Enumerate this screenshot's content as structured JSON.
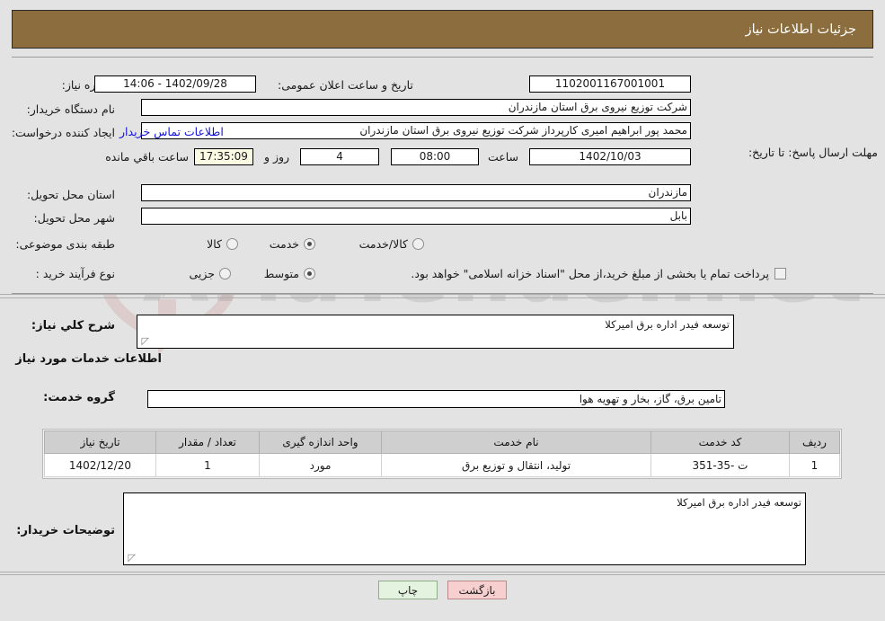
{
  "header": {
    "title": "جزئیات اطلاعات نیاز"
  },
  "form": {
    "need_number_label": "شماره نیاز:",
    "need_number_value": "1102001167001001",
    "announce_label": "تاریخ و ساعت اعلان عمومی:",
    "announce_value": "1402/09/28 - 14:06",
    "buyer_org_label": "نام دستگاه خریدار:",
    "buyer_org_value": "شرکت توزیع نیروی برق استان مازندران",
    "creator_label": "ایجاد کننده درخواست:",
    "creator_value": "محمد پور ابراهیم امیری کارپرداز شرکت توزیع نیروی برق استان مازندران",
    "buyer_contact_link": "اطلاعات تماس خریدار",
    "deadline_label": "مهلت ارسال پاسخ: تا تاریخ:",
    "deadline_date": "1402/10/03",
    "deadline_time_label": "ساعت",
    "deadline_time": "08:00",
    "remaining_days": "4",
    "remaining_days_label": "روز و",
    "remaining_clock": "17:35:09",
    "remaining_suffix": "ساعت باقي مانده",
    "province_label": "استان محل تحویل:",
    "province_value": "مازندران",
    "city_label": "شهر محل تحویل:",
    "city_value": "بابل",
    "classification_label": "طبقه بندی موضوعی:",
    "classification_options": [
      {
        "label": "کالا",
        "selected": false
      },
      {
        "label": "خدمت",
        "selected": true
      },
      {
        "label": "کالا/خدمت",
        "selected": false
      }
    ],
    "process_label": "نوع فرآیند خرید :",
    "process_options": [
      {
        "label": "جزیی",
        "selected": false
      },
      {
        "label": "متوسط",
        "selected": true
      }
    ],
    "treasury_checkbox_label": "پرداخت تمام یا بخشی از مبلغ خرید،از محل \"اسناد خزانه اسلامی\" خواهد بود.",
    "treasury_checked": false
  },
  "summary": {
    "label": "شرح کلي نياز:",
    "value": "توسعه فیدر اداره برق امیرکلا"
  },
  "services_section": {
    "title": "اطلاعات خدمات مورد نیاز",
    "group_label": "گروه خدمت:",
    "group_value": "تامین برق، گاز، بخار و تهویه هوا"
  },
  "table": {
    "columns": [
      "ردیف",
      "کد خدمت",
      "نام خدمت",
      "واحد اندازه گیری",
      "تعداد / مقدار",
      "تاریخ نیاز"
    ],
    "rows": [
      {
        "row": "1",
        "service_code": "ت -35-351",
        "service_name": "تولید، انتقال و توزیع برق",
        "unit": "مورد",
        "quantity": "1",
        "need_date": "1402/12/20"
      }
    ]
  },
  "buyer_notes": {
    "label": "توضیحات خریدار:",
    "value": "توسعه فیدر اداره برق امیرکلا"
  },
  "footer": {
    "back_button": "بازگشت",
    "print_button": "چاپ"
  },
  "watermark": {
    "text": "AriaTender.net"
  },
  "colors": {
    "header_bg": "#8b6d3e",
    "link": "#1414d8",
    "back_button_bg": "#f8cfcf",
    "print_button_bg": "#e4f3e0",
    "clock_field_bg": "#fbfbe4",
    "table_header_bg": "#cfcfcf",
    "page_bg": "#e3e3e3"
  }
}
